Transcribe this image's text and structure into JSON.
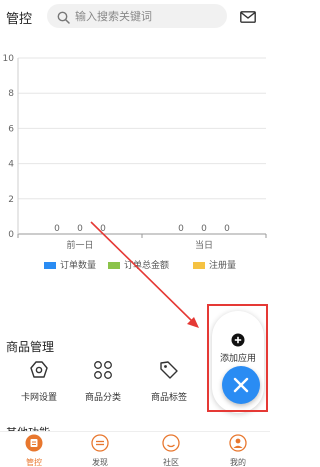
{
  "header": {
    "title": "管控",
    "search_placeholder": "输入搜索关键词"
  },
  "chart_data": {
    "type": "bar",
    "categories": [
      "前一日",
      "当日"
    ],
    "series": [
      {
        "name": "订单数量",
        "color": "#2a8cf3",
        "values": [
          0,
          0
        ]
      },
      {
        "name": "订单总金额",
        "color": "#8bc34a",
        "values": [
          0,
          0
        ]
      },
      {
        "name": "注册量",
        "color": "#f5c242",
        "values": [
          0,
          0
        ]
      }
    ],
    "ylim": [
      0,
      10
    ],
    "yticks": [
      0,
      2,
      4,
      6,
      8,
      10
    ],
    "grid": true,
    "legend": "bottom"
  },
  "goods": {
    "title": "商品管理",
    "items": [
      {
        "label": "卡网设置",
        "icon": "settings-gear-icon"
      },
      {
        "label": "商品分类",
        "icon": "grid-category-icon"
      },
      {
        "label": "商品标签",
        "icon": "tag-icon"
      }
    ]
  },
  "other": {
    "title": "其他功能"
  },
  "fab": {
    "add_label": "添加应用"
  },
  "nav": {
    "items": [
      {
        "label": "管控",
        "icon": "control-icon",
        "active": true
      },
      {
        "label": "发现",
        "icon": "discover-icon",
        "active": false
      },
      {
        "label": "社区",
        "icon": "community-icon",
        "active": false
      },
      {
        "label": "我的",
        "icon": "profile-icon",
        "active": false
      }
    ]
  },
  "colors": {
    "accent_orange": "#e8772e",
    "fab_blue": "#2a8cf3",
    "highlight_red": "#e53935"
  }
}
